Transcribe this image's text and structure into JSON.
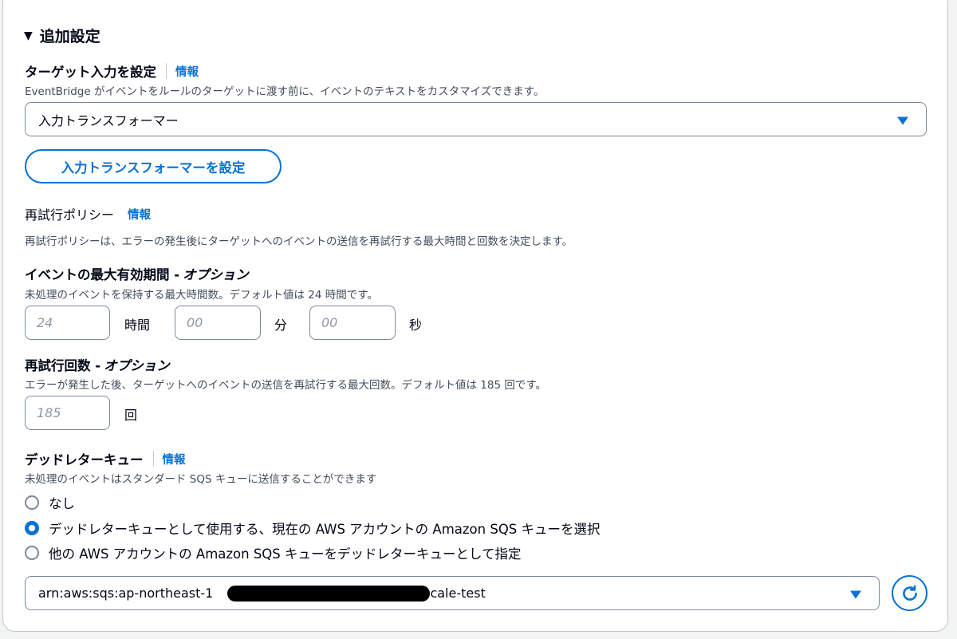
{
  "section": {
    "title": "追加設定",
    "caret_icon": "caret-down-icon"
  },
  "target_input": {
    "label": "ターゲット入力を設定",
    "info": "情報",
    "description": "EventBridge がイベントをルールのターゲットに渡す前に、イベントのテキストをカスタマイズできます。",
    "select_value": "入力トランスフォーマー",
    "configure_button": "入力トランスフォーマーを設定"
  },
  "retry_policy": {
    "label": "再試行ポリシー",
    "info": "情報",
    "description": "再試行ポリシーは、エラーの発生後にターゲットへのイベントの送信を再試行する最大時間と回数を決定します。"
  },
  "max_age": {
    "label": "イベントの最大有効期間 - ",
    "label_optional": "オプション",
    "description": "未処理のイベントを保持する最大時間数。デフォルト値は 24 時間です。",
    "hours_placeholder": "24",
    "hours_unit": "時間",
    "minutes_placeholder": "00",
    "minutes_unit": "分",
    "seconds_placeholder": "00",
    "seconds_unit": "秒"
  },
  "retry_attempts": {
    "label": "再試行回数 - ",
    "label_optional": "オプション",
    "description": "エラーが発生した後、ターゲットへのイベントの送信を再試行する最大回数。デフォルト値は 185 回です。",
    "placeholder": "185",
    "unit": "回"
  },
  "dead_letter": {
    "label": "デッドレターキュー",
    "info": "情報",
    "description": "未処理のイベントはスタンダード SQS キューに送信することができます",
    "options": [
      {
        "label": "なし",
        "checked": false
      },
      {
        "label": "デッドレターキューとして使用する、現在の AWS アカウントの Amazon SQS キューを選択",
        "checked": true
      },
      {
        "label": "他の AWS アカウントの Amazon SQS キューをデッドレターキューとして指定",
        "checked": false
      }
    ],
    "arn_prefix": "arn:aws:sqs:ap-northeast-1",
    "arn_suffix": "-scale-test",
    "refresh_icon": "refresh-icon"
  },
  "colors": {
    "accent": "#0972d3",
    "border": "#7d8998",
    "text": "#000716",
    "secondary_text": "#414d5c"
  }
}
